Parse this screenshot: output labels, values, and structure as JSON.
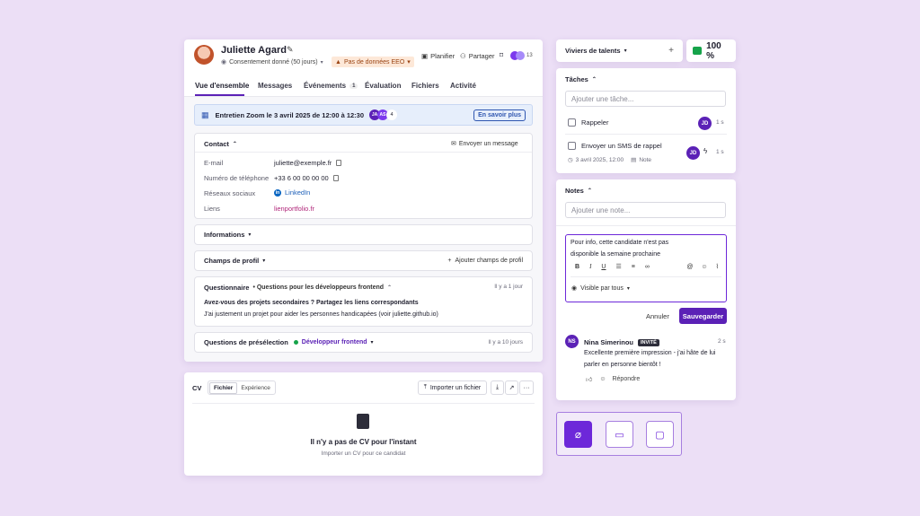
{
  "candidate": {
    "name": "Juliette Agard",
    "consent": "Consentement donné (50 jours)",
    "eeo_badge": "Pas de données EEO",
    "actions": {
      "plan": "Planifier",
      "share": "Partager",
      "avatar_count": "13"
    }
  },
  "tabs": [
    {
      "label": "Vue d'ensemble"
    },
    {
      "label": "Messages"
    },
    {
      "label": "Événements",
      "count": "1"
    },
    {
      "label": "Évaluation"
    },
    {
      "label": "Fichiers"
    },
    {
      "label": "Activité"
    }
  ],
  "banner": {
    "text": "Entretien Zoom le 3 avril 2025 de 12:00 à 12:30",
    "avatars": [
      "JA",
      "AS"
    ],
    "count": "4",
    "link": "En savoir plus"
  },
  "contact": {
    "title": "Contact",
    "send_message": "Envoyer un message",
    "fields": [
      {
        "label": "E-mail",
        "value": "juliette@exemple.fr"
      },
      {
        "label": "Numéro de téléphone",
        "value": "+33 6 00 00 00 00"
      },
      {
        "label": "Réseaux sociaux",
        "value": "LinkedIn"
      },
      {
        "label": "Liens",
        "value": "lienportfolio.fr"
      }
    ]
  },
  "informations": {
    "title": "Informations"
  },
  "profile_fields": {
    "title": "Champs de profil",
    "add": "Ajouter champs de profil"
  },
  "questionnaire": {
    "title": "Questionnaire",
    "subtitle": "• Questions pour les développeurs frontend",
    "time": "Il y a 1 jour",
    "question": "Avez-vous des projets secondaires ? Partagez les liens correspondants",
    "answer": "J'ai justement un projet pour aider les personnes handicapées (voir juliette.github.io)"
  },
  "preselection": {
    "title": "Questions de présélection",
    "tag": "Développeur frontend",
    "time": "Il y a 10 jours"
  },
  "cv": {
    "label": "CV",
    "toggle": [
      "Fichier",
      "Expérience"
    ],
    "import_button": "Importer un fichier",
    "empty_title": "Il n'y a pas de CV pour l'instant",
    "empty_sub": "Importer un CV pour ce candidat"
  },
  "talent_pools": {
    "label": "Viviers de talents",
    "add": "+"
  },
  "score": {
    "value": "100 %"
  },
  "tasks": {
    "title": "Tâches",
    "placeholder": "Ajouter une tâche...",
    "items": [
      {
        "label": "Rappeler",
        "avatar": "JD",
        "time": "1 s"
      },
      {
        "label": "Envoyer un SMS de rappel",
        "avatar": "JD",
        "time": "1 s",
        "date": "3 avril 2025, 12:00",
        "note": "Note"
      }
    ]
  },
  "notes": {
    "title": "Notes",
    "placeholder": "Ajouter une note...",
    "draft_line1": "Pour info, cette candidate n'est pas",
    "draft_line2": "disponible la semaine prochaine",
    "visibility": "Visible par tous",
    "cancel": "Annuler",
    "save": "Sauvegarder",
    "comment": {
      "initials": "NS",
      "author": "Nina Simerinou",
      "badge": "INVITÉ",
      "time": "2 s",
      "line1": "Excellente première impression - j'ai hâte de lui",
      "line2": "parler en personne bientôt !",
      "reply": "Répondre"
    }
  },
  "colors": {
    "accent": "#5b21b6",
    "banner_bg": "#e6eefb",
    "eeo_bg": "#fde8d8",
    "background": "#ecdff6"
  }
}
